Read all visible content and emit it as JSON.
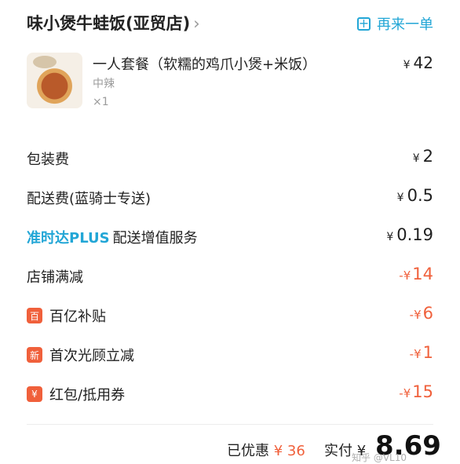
{
  "header": {
    "shop_name": "味小煲牛蛙饭(亚贸店)",
    "shop_chevron": "›",
    "reorder_label": "再来一单",
    "reorder_icon": "+"
  },
  "item": {
    "name": "一人套餐（软糯的鸡爪小煲+米饭）",
    "spec": "中辣",
    "qty": "×1",
    "price_currency": "¥",
    "price": "42"
  },
  "fees": [
    {
      "label": "包装费",
      "currency": "¥",
      "value": "2"
    },
    {
      "label": "配送费(蓝骑士专送)",
      "currency": "¥",
      "value": "0.5"
    },
    {
      "label_highlight": "准时达PLUS",
      "label": "配送增值服务",
      "currency": "¥",
      "value": "0.19"
    },
    {
      "label": "店铺满减",
      "currency": "-¥",
      "value": "14"
    },
    {
      "badge": "百",
      "label": "百亿补贴",
      "currency": "-¥",
      "value": "6"
    },
    {
      "badge": "新",
      "label": "首次光顾立减",
      "currency": "-¥",
      "value": "1"
    },
    {
      "badge": "¥",
      "label": "红包/抵用券",
      "currency": "-¥",
      "value": "15"
    }
  ],
  "footer": {
    "saved_label": "已优惠",
    "saved_amount": "¥ 36",
    "paid_label": "实付 ¥",
    "total": "8.69"
  },
  "watermark": "知乎 @VL10",
  "colors": {
    "accent_blue": "#22a6d6",
    "discount_red": "#f0603b"
  }
}
